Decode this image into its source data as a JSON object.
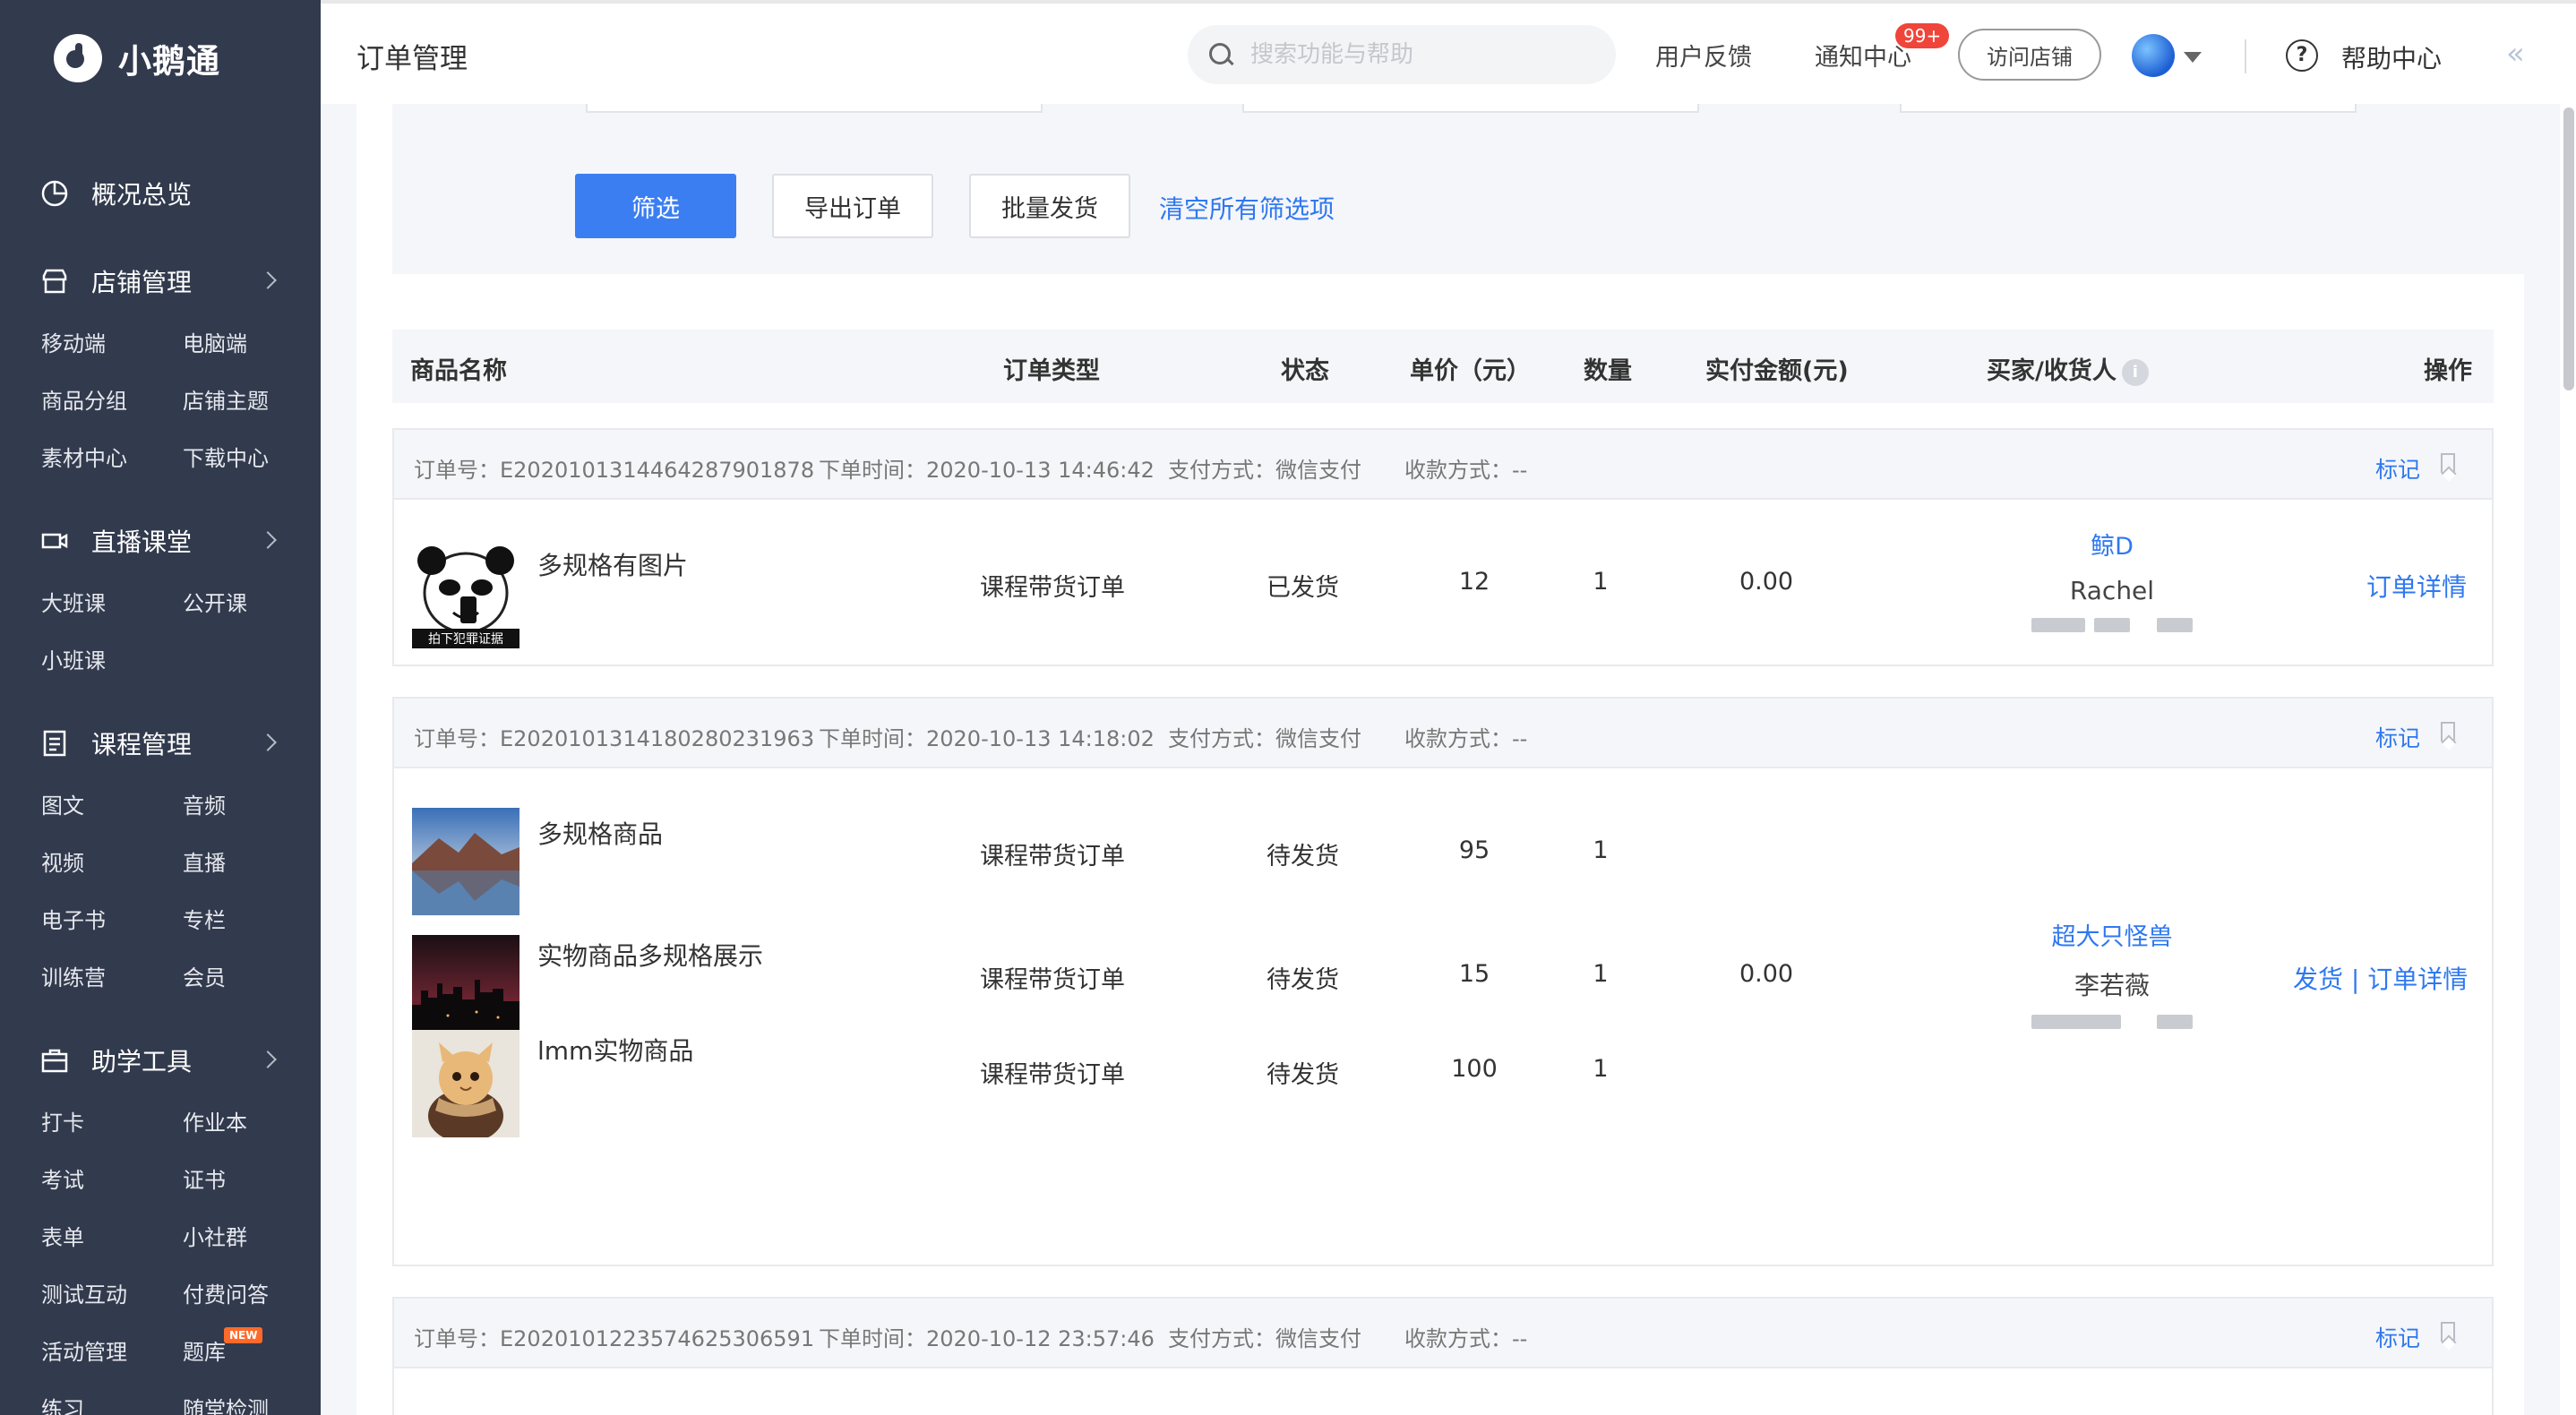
{
  "brand": {
    "name": "小鹅通"
  },
  "sidebar": {
    "overview": {
      "label": "概况总览"
    },
    "shop": {
      "label": "店铺管理",
      "items": [
        "移动端",
        "电脑端",
        "商品分组",
        "店铺主题",
        "素材中心",
        "下载中心"
      ]
    },
    "live": {
      "label": "直播课堂",
      "items": [
        "大班课",
        "公开课",
        "小班课"
      ]
    },
    "course": {
      "label": "课程管理",
      "items": [
        "图文",
        "音频",
        "视频",
        "直播",
        "电子书",
        "专栏",
        "训练营",
        "会员"
      ]
    },
    "tools": {
      "label": "助学工具",
      "items": [
        "打卡",
        "作业本",
        "考试",
        "证书",
        "表单",
        "小社群",
        "测试互动",
        "付费问答",
        "活动管理",
        "题库",
        "练习",
        "随堂检测"
      ],
      "new_badge": "NEW"
    }
  },
  "topbar": {
    "title": "订单管理",
    "search_placeholder": "搜索功能与帮助",
    "feedback": "用户反馈",
    "notify": "通知中心",
    "notify_badge": "99+",
    "visit_shop": "访问店铺",
    "help": "帮助中心"
  },
  "filters": {
    "filter_button": "筛选",
    "export_button": "导出订单",
    "batch_ship_button": "批量发货",
    "clear_link": "清空所有筛选项"
  },
  "table": {
    "headers": [
      "商品名称",
      "订单类型",
      "状态",
      "单价（元）",
      "数量",
      "实付金额(元)",
      "买家/收货人",
      "操作"
    ],
    "info_icon": "i"
  },
  "orders": [
    {
      "order_no": "订单号：E20201013144642879 01878",
      "order_no_text": "订单号：E202010131446428790 1878",
      "order_no_label": "订单号：",
      "order_no_value": "E2020101314464287901878",
      "time_label": "下单时间：",
      "time_value": "2020-10-13 14:46:42",
      "pay_label": "支付方式：",
      "pay_value": "微信支付",
      "collect_label": "收款方式：",
      "collect_value": "--",
      "mark": "标记",
      "items": [
        {
          "name": "多规格有图片",
          "type": "课程带货订单",
          "status": "已发货",
          "price": "12",
          "qty": "1",
          "thumb_caption": "拍下犯罪证据"
        }
      ],
      "total": "0.00",
      "buyer": "鲸D",
      "receiver": "Rachel",
      "action": "订单详情"
    },
    {
      "order_no_label": "订单号：",
      "order_no_value": "E2020101314180280231963",
      "time_label": "下单时间：",
      "time_value": "2020-10-13 14:18:02",
      "pay_label": "支付方式：",
      "pay_value": "微信支付",
      "collect_label": "收款方式：",
      "collect_value": "--",
      "mark": "标记",
      "items": [
        {
          "name": "多规格商品",
          "type": "课程带货订单",
          "status": "待发货",
          "price": "95",
          "qty": "1"
        },
        {
          "name": "实物商品多规格展示",
          "type": "课程带货订单",
          "status": "待发货",
          "price": "15",
          "qty": "1"
        },
        {
          "name": "lmm实物商品",
          "type": "课程带货订单",
          "status": "待发货",
          "price": "100",
          "qty": "1"
        }
      ],
      "total": "0.00",
      "buyer": "超大只怪兽",
      "receiver": "李若薇",
      "action": "发货 | 订单详情"
    },
    {
      "order_no_label": "订单号：",
      "order_no_value": "E2020101223574625306591",
      "time_label": "下单时间：",
      "time_value": "2020-10-12 23:57:46",
      "pay_label": "支付方式：",
      "pay_value": "微信支付",
      "collect_label": "收款方式：",
      "collect_value": "--",
      "mark": "标记"
    }
  ],
  "colors": {
    "sidebar_bg": "#323a4d",
    "primary": "#3b7ef2",
    "link": "#2f78f0",
    "badge": "#f0453a"
  }
}
